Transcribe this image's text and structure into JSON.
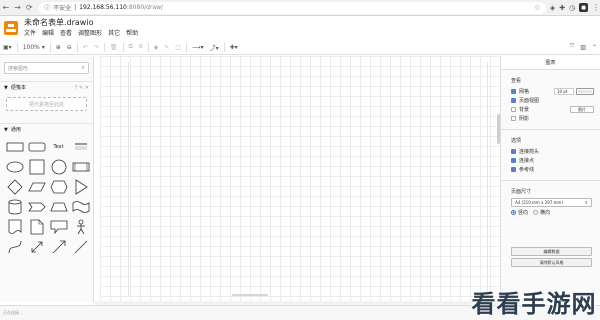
{
  "browser": {
    "nav": [
      "←",
      "→",
      "C"
    ],
    "security": "不安全",
    "host": "192.168.56.110",
    "path": ":8080/draw/",
    "menu_glyph": "⋮"
  },
  "app": {
    "file_name": "未命名表单.drawio",
    "menus": [
      "文件",
      "编辑",
      "查看",
      "调整图形",
      "其它",
      "帮助"
    ]
  },
  "toolbar": {
    "zoom": "100%"
  },
  "left_panel": {
    "search_placeholder": "搜索图形",
    "scratchpad_title": "便笺本",
    "scratchpad_actions": "? ✎ ✕",
    "scratchpad_hint": "把元素拖至此处",
    "general_title": "通用",
    "text_shape_label": "Text"
  },
  "right_panel": {
    "tab": "图表",
    "view_title": "查看",
    "grid_label": "网格",
    "grid_size": "10 pt",
    "page_view_label": "页面视图",
    "background_label": "背景",
    "image_button": "图片",
    "shadow_label": "阴影",
    "options_title": "选项",
    "connection_arrows_label": "连接箭头",
    "connection_points_label": "连接点",
    "guides_label": "参考线",
    "paper_size_title": "页面尺寸",
    "paper_size_value": "A4 (210 mm x 297 mm)",
    "portrait_label": "竖向",
    "landscape_label": "横向",
    "edit_data_button": "编辑数据",
    "clear_default_style_button": "清除默认风格"
  },
  "status_bar": {
    "text": "正在连接…"
  },
  "watermark": "看看手游网",
  "colors": {
    "accent": "#5b7fcc",
    "logo": "#f08705"
  }
}
